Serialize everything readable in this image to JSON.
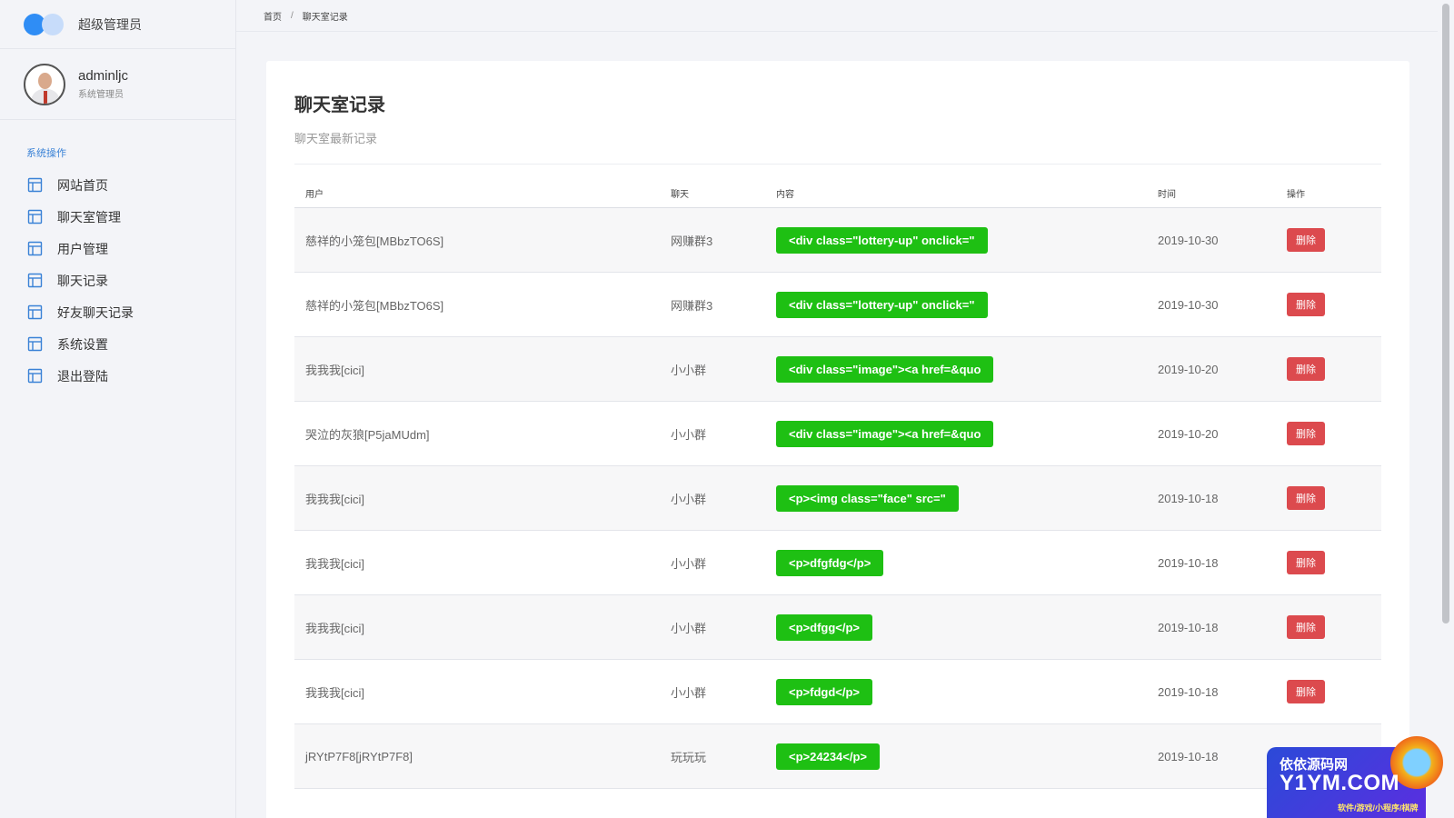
{
  "brand": {
    "name": "超级管理员"
  },
  "user": {
    "name": "adminljc",
    "role": "系统管理员"
  },
  "menu": {
    "title": "系统操作",
    "items": [
      {
        "label": "网站首页"
      },
      {
        "label": "聊天室管理"
      },
      {
        "label": "用户管理"
      },
      {
        "label": "聊天记录"
      },
      {
        "label": "好友聊天记录"
      },
      {
        "label": "系统设置"
      },
      {
        "label": "退出登陆"
      }
    ]
  },
  "breadcrumb": {
    "home": "首页",
    "separator": "/",
    "current": "聊天室记录"
  },
  "card": {
    "title": "聊天室记录",
    "subtitle": "聊天室最新记录"
  },
  "table": {
    "headers": {
      "user": "用户",
      "room": "聊天",
      "content": "内容",
      "time": "时间",
      "action": "操作"
    },
    "rows": [
      {
        "user": "慈祥的小笼包[MBbzTO6S]",
        "room": "网赚群3",
        "content": "<div class=\"lottery-up\" onclick=\"",
        "time": "2019-10-30",
        "action": "删除"
      },
      {
        "user": "慈祥的小笼包[MBbzTO6S]",
        "room": "网赚群3",
        "content": "<div class=\"lottery-up\" onclick=\"",
        "time": "2019-10-30",
        "action": "删除"
      },
      {
        "user": "我我我[cici]",
        "room": "小小群",
        "content": "<div class=\"image\"><a href=&quo",
        "time": "2019-10-20",
        "action": "删除"
      },
      {
        "user": "哭泣的灰狼[P5jaMUdm]",
        "room": "小小群",
        "content": "<div class=\"image\"><a href=&quo",
        "time": "2019-10-20",
        "action": "删除"
      },
      {
        "user": "我我我[cici]",
        "room": "小小群",
        "content": "<p><img class=\"face\" src=\"",
        "time": "2019-10-18",
        "action": "删除"
      },
      {
        "user": "我我我[cici]",
        "room": "小小群",
        "content": "<p>dfgfdg</p>",
        "time": "2019-10-18",
        "action": "删除"
      },
      {
        "user": "我我我[cici]",
        "room": "小小群",
        "content": "<p>dfgg</p>",
        "time": "2019-10-18",
        "action": "删除"
      },
      {
        "user": "我我我[cici]",
        "room": "小小群",
        "content": "<p>fdgd</p>",
        "time": "2019-10-18",
        "action": "删除"
      },
      {
        "user": "jRYtP7F8[jRYtP7F8]",
        "room": "玩玩玩",
        "content": "<p>24234</p>",
        "time": "2019-10-18",
        "action": ""
      }
    ]
  },
  "watermark": {
    "line1": "依依源码网",
    "line2": "Y1YM.COM",
    "line3": "软件/游戏/小程序/棋牌"
  },
  "colors": {
    "accent": "#2f8df5",
    "content_tag": "#1ec013",
    "delete_button": "#dc4a4e",
    "menu_title": "#3a82d6"
  },
  "icons": {
    "menu_item": "layout-table-icon"
  }
}
